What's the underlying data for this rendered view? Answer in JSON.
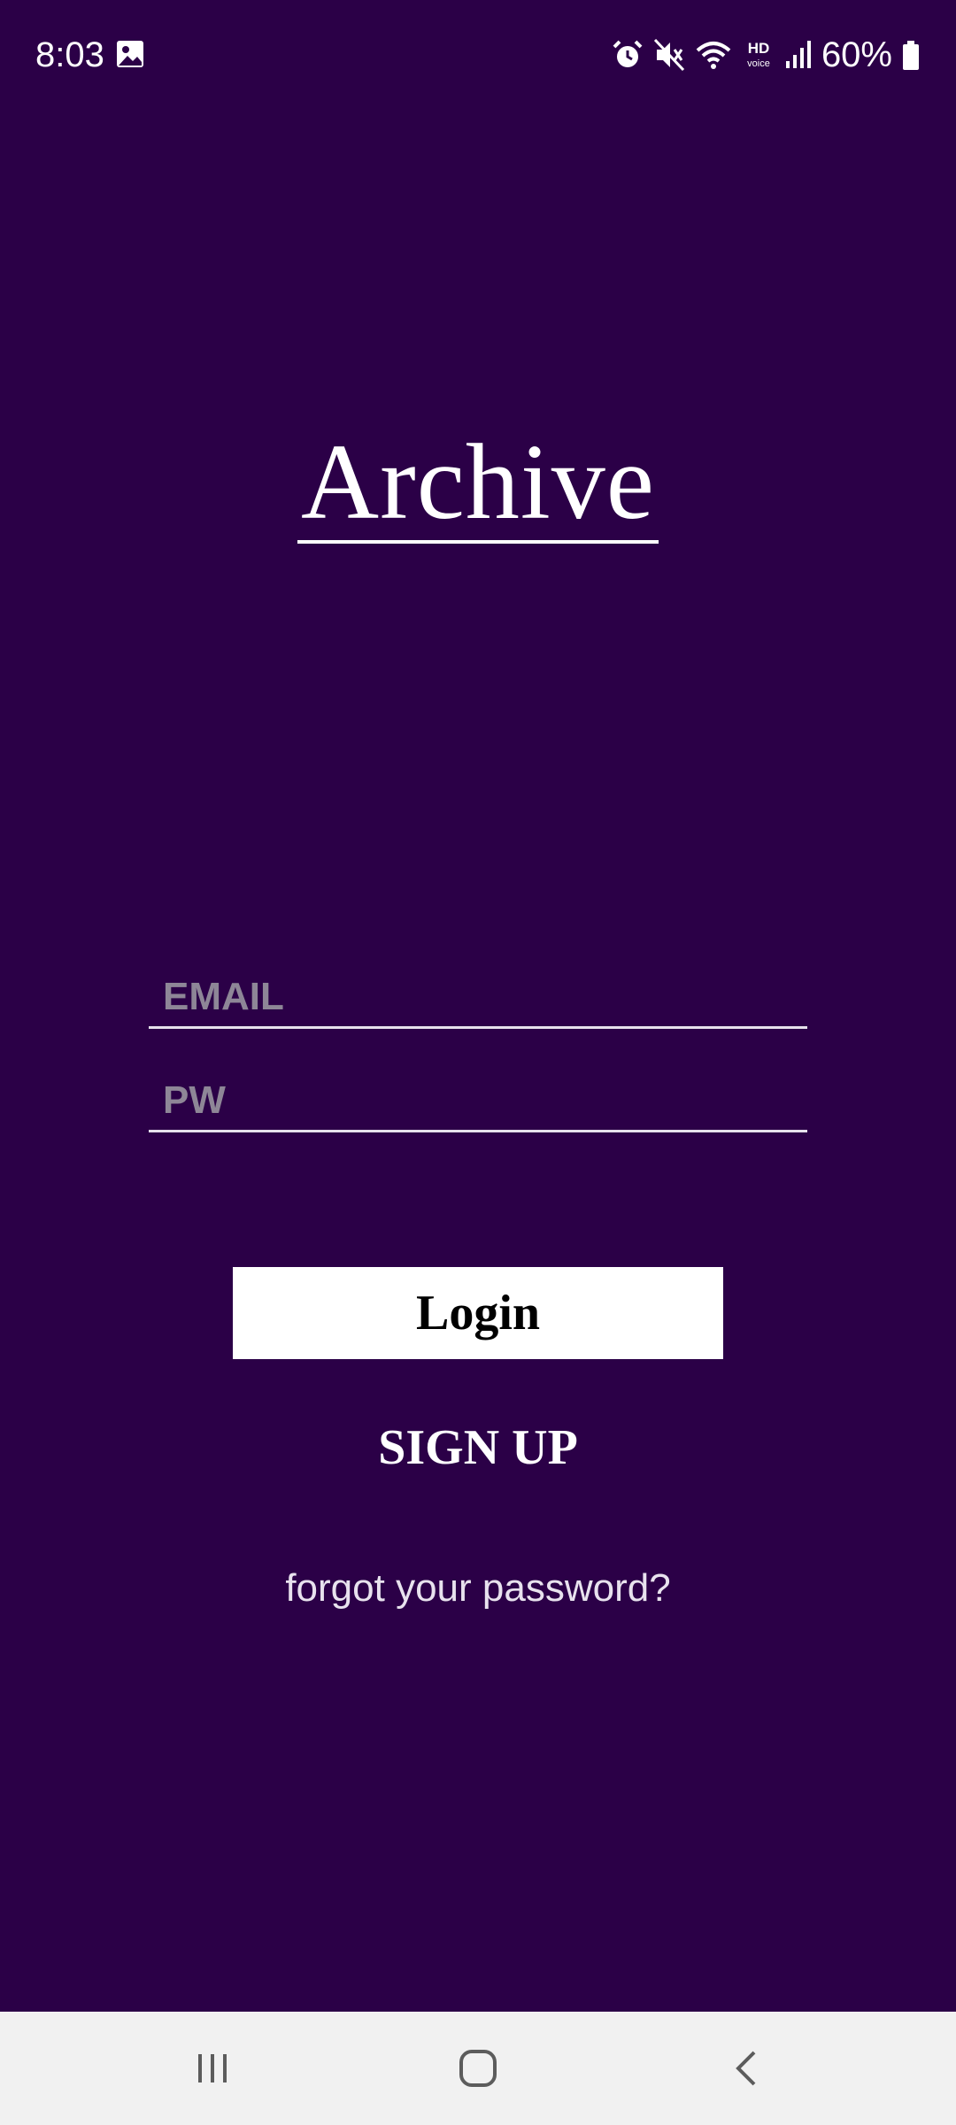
{
  "status_bar": {
    "time": "8:03",
    "battery": "60%",
    "icons": [
      "gallery-icon",
      "alarm-icon",
      "mute-icon",
      "wifi-icon",
      "hd-voice-icon",
      "signal-icon",
      "battery-icon"
    ]
  },
  "logo": {
    "text": "Archive"
  },
  "form": {
    "email_placeholder": "EMAIL",
    "pw_placeholder": "PW",
    "login_label": "Login",
    "signup_label": "SIGN UP",
    "forgot_label": "forgot your password?"
  },
  "nav_bar": {
    "icons": [
      "recents-icon",
      "home-icon",
      "back-icon"
    ]
  },
  "colors": {
    "background": "#2b0047",
    "text": "#ffffff",
    "placeholder": "#8e8697",
    "nav_bar": "#f1f1f1"
  }
}
